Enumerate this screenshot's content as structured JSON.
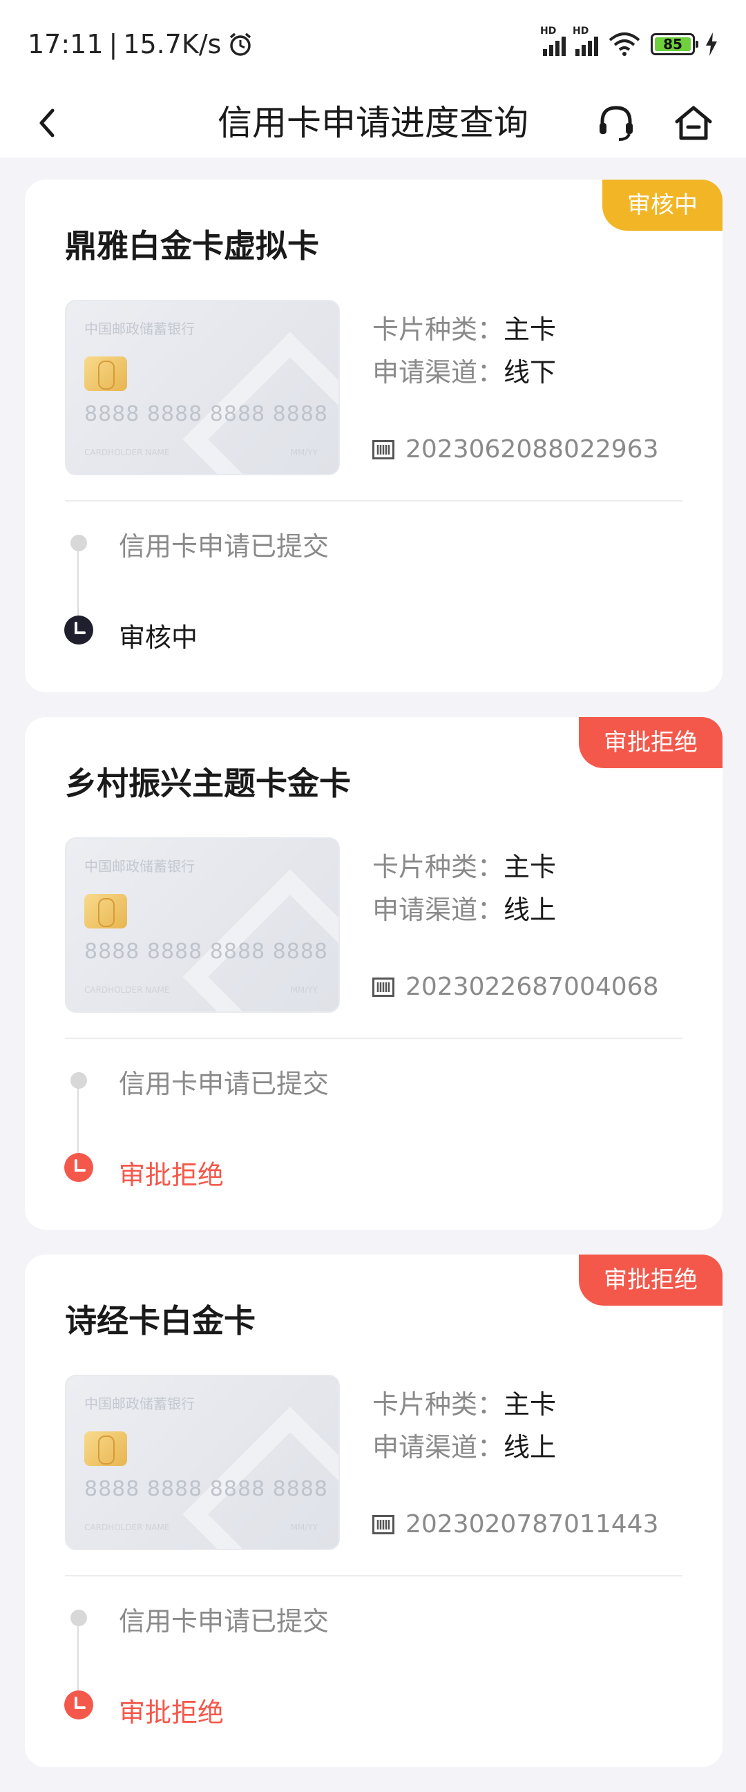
{
  "statusbar": {
    "time": "17:11",
    "speed": "15.7K/s",
    "battery": "85",
    "hd_label": "HD",
    "icons": [
      "alarm-icon",
      "signal-icon",
      "signal-icon",
      "wifi-icon",
      "battery-icon",
      "charging-icon"
    ]
  },
  "header": {
    "title": "信用卡申请进度查询",
    "icons": [
      "back-arrow-icon",
      "customer-service-icon",
      "home-icon"
    ]
  },
  "card_image": {
    "bank_name": "中国邮政储蓄银行",
    "number": "8888 8888 8888 8888",
    "holder": "CARDHOLDER NAME",
    "valid": "MM/YY"
  },
  "labels": {
    "card_type": "卡片种类：",
    "channel": "申请渠道：",
    "submitted": "信用卡申请已提交"
  },
  "applications": [
    {
      "name": "鼎雅白金卡虚拟卡",
      "status": "审核中",
      "status_color": "#f2b526",
      "card_type": "主卡",
      "channel": "线下",
      "order_no": "2023062088022963",
      "step2": "审核中"
    },
    {
      "name": "乡村振兴主题卡金卡",
      "status": "审批拒绝",
      "status_color": "#f4584b",
      "card_type": "主卡",
      "channel": "线上",
      "order_no": "2023022687004068",
      "step2": "审批拒绝"
    },
    {
      "name": "诗经卡白金卡",
      "status": "审批拒绝",
      "status_color": "#f4584b",
      "card_type": "主卡",
      "channel": "线上",
      "order_no": "2023020787011443",
      "step2": "审批拒绝"
    }
  ]
}
